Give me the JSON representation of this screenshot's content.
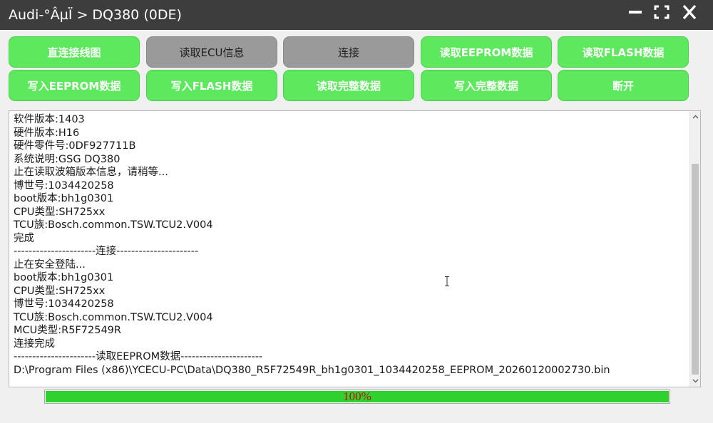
{
  "window": {
    "title": "Audi-°ÂµÏ > DQ380 (0DE)",
    "minimize_icon": "minimize-icon",
    "maximize_icon": "maximize-icon",
    "close_icon": "close-icon"
  },
  "buttons": [
    {
      "label": "直连接线图",
      "style": "green"
    },
    {
      "label": "读取ECU信息",
      "style": "gray"
    },
    {
      "label": "连接",
      "style": "gray"
    },
    {
      "label": "读取EEPROM数据",
      "style": "green"
    },
    {
      "label": "读取FLASH数据",
      "style": "green"
    },
    {
      "label": "写入EEPROM数据",
      "style": "green"
    },
    {
      "label": "写入FLASH数据",
      "style": "green"
    },
    {
      "label": "读取完整数据",
      "style": "green"
    },
    {
      "label": "写入完整数据",
      "style": "green"
    },
    {
      "label": "断开",
      "style": "green"
    }
  ],
  "log": {
    "lines": [
      "软件版本:1403",
      "硬件版本:H16",
      "硬件零件号:0DF927711B",
      "系统说明:GSG DQ380",
      "止在读取波箱版本信息，请稍等...",
      "博世号:1034420258",
      "boot版本:bh1g0301",
      "CPU类型:SH725xx",
      "TCU族:Bosch.common.TSW.TCU2.V004",
      "完成",
      "----------------------连接----------------------",
      "止在安全登陆...",
      "boot版本:bh1g0301",
      "CPU类型:SH725xx",
      "博世号:1034420258",
      "TCU族:Bosch.common.TSW.TCU2.V004",
      "MCU类型:R5F72549R",
      "连接完成",
      "----------------------读取EEPROM数据----------------------",
      "D:\\Program Files (x86)\\YCECU-PC\\Data\\DQ380_R5F72549R_bh1g0301_1034420258_EEPROM_20260120002730.bin"
    ]
  },
  "progress": {
    "percent": 100,
    "label": "100%"
  },
  "colors": {
    "titlebar": "#3d3d3d",
    "button_green": "#5ee85e",
    "button_gray": "#9a9a9a",
    "progress_fill": "#2ed12e",
    "progress_text": "#c01010"
  }
}
